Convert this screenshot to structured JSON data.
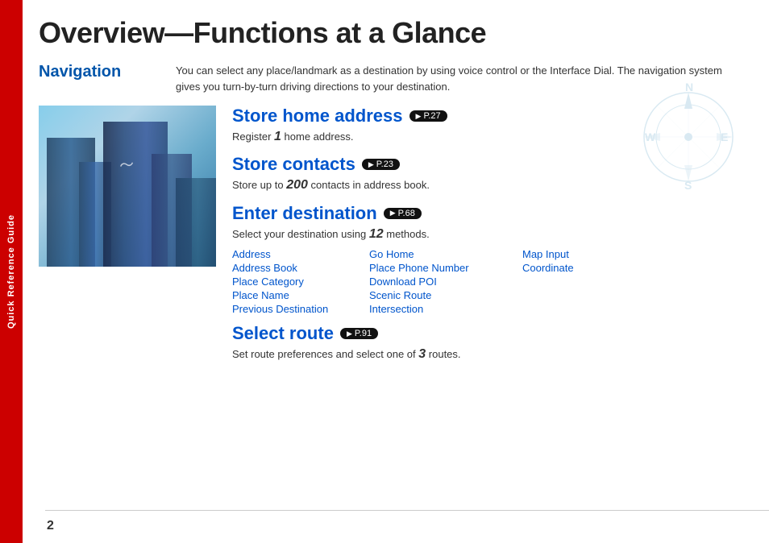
{
  "sidebar": {
    "label": "Quick Reference Guide"
  },
  "page": {
    "title": "Overview—Functions at a Glance",
    "number": "2"
  },
  "navigation": {
    "section_label": "Navigation",
    "description": "You can select any place/landmark as a destination by using voice control or the Interface Dial. The navigation system gives you turn-by-turn driving directions to your destination.",
    "store_home": {
      "heading": "Store home address",
      "page_ref": "P.27",
      "sub_text_prefix": "Register ",
      "sub_text_bold": "1",
      "sub_text_suffix": " home address."
    },
    "store_contacts": {
      "heading": "Store contacts",
      "page_ref": "P.23",
      "sub_text_prefix": "Store up to ",
      "sub_text_bold": "200",
      "sub_text_suffix": " contacts in address book."
    },
    "enter_destination": {
      "heading": "Enter destination",
      "page_ref": "P.68",
      "sub_text_prefix": "Select your destination using ",
      "sub_text_bold": "12",
      "sub_text_suffix": " methods."
    },
    "methods": [
      {
        "col": 0,
        "label": "Address"
      },
      {
        "col": 1,
        "label": "Go Home"
      },
      {
        "col": 2,
        "label": "Map Input"
      },
      {
        "col": 0,
        "label": "Address Book"
      },
      {
        "col": 1,
        "label": "Place Phone Number"
      },
      {
        "col": 2,
        "label": "Coordinate"
      },
      {
        "col": 0,
        "label": "Place Category"
      },
      {
        "col": 1,
        "label": "Download POI"
      },
      {
        "col": 0,
        "label": "Place Name"
      },
      {
        "col": 1,
        "label": "Scenic Route"
      },
      {
        "col": 0,
        "label": "Previous Destination"
      },
      {
        "col": 1,
        "label": "Intersection"
      }
    ],
    "select_route": {
      "heading": "Select route",
      "page_ref": "P.91",
      "sub_text_prefix": "Set route preferences and select one of ",
      "sub_text_bold": "3",
      "sub_text_suffix": " routes."
    }
  }
}
